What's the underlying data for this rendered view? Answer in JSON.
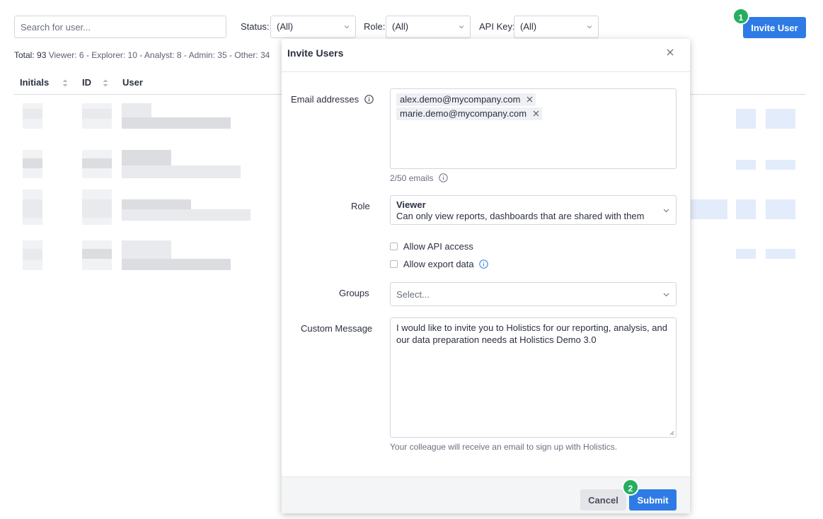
{
  "toolbar": {
    "search_placeholder": "Search for user...",
    "status_label": "Status:",
    "status_value": "(All)",
    "role_label": "Role:",
    "role_value": "(All)",
    "apikey_label": "API Key:",
    "apikey_value": "(All)",
    "invite_button": "Invite User",
    "step1": "1"
  },
  "totals": {
    "total": "Total: 93",
    "breakdown": "Viewer: 6 - Explorer: 10 - Analyst: 8 - Admin: 35 - Other: 34"
  },
  "table": {
    "columns": [
      "Initials",
      "ID",
      "User"
    ]
  },
  "modal": {
    "title": "Invite Users",
    "email_label": "Email addresses",
    "emails": [
      "alex.demo@mycompany.com",
      "marie.demo@mycompany.com"
    ],
    "email_count": "2/50 emails",
    "role_label": "Role",
    "role_name": "Viewer",
    "role_desc": "Can only view reports, dashboards that are shared with them",
    "allow_api": "Allow API access",
    "allow_export": "Allow export data",
    "groups_label": "Groups",
    "groups_placeholder": "Select...",
    "message_label": "Custom Message",
    "message": "I would like to invite you to Holistics for our reporting, analysis, and our data preparation needs at Holistics Demo 3.0",
    "message_hint": "Your colleague will receive an email to sign up with Holistics.",
    "cancel": "Cancel",
    "submit": "Submit",
    "step2": "2"
  },
  "colors": {
    "primary": "#2f7be5",
    "step_badge": "#27ae60"
  }
}
